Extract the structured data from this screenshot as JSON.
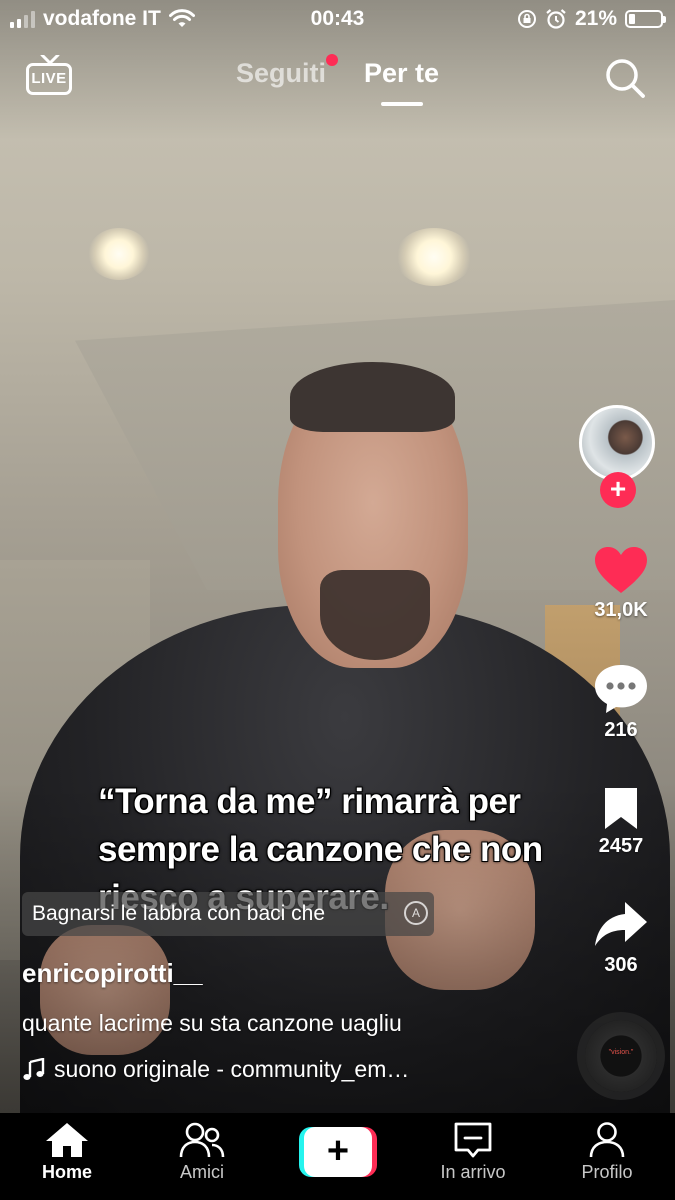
{
  "status_bar": {
    "carrier": "vodafone IT",
    "time": "00:43",
    "battery_percent": "21%",
    "battery_level": 0.21,
    "icons": [
      "signal-icon",
      "wifi-icon",
      "orientation-lock-icon",
      "alarm-icon",
      "battery-icon"
    ]
  },
  "top_nav": {
    "live_label": "LIVE",
    "tabs": [
      {
        "label": "Seguiti",
        "active": false,
        "has_notification_dot": true
      },
      {
        "label": "Per te",
        "active": true
      }
    ],
    "search_icon": "search-icon"
  },
  "video": {
    "overlay_text": "“Torna da me” rimarrà per sempre la canzone che non riesco a superare.",
    "lyrics": "Bagnarsi le labbra con baci che"
  },
  "actions": {
    "follow_label": "+",
    "likes": "31,0K",
    "comments": "216",
    "saves": "2457",
    "shares": "306",
    "like_color": "#fe2c55"
  },
  "post": {
    "username": "enricopirotti__",
    "description": "quante lacrime su sta canzone uagliu",
    "sound": "suono originale - community_em…",
    "disc_label": "\"vision.\""
  },
  "tab_bar": {
    "items": [
      {
        "label": "Home",
        "icon": "home-icon",
        "active": true
      },
      {
        "label": "Amici",
        "icon": "friends-icon",
        "active": false
      },
      {
        "label": "+",
        "icon": "create-icon",
        "active": false
      },
      {
        "label": "In arrivo",
        "icon": "inbox-icon",
        "active": false
      },
      {
        "label": "Profilo",
        "icon": "profile-icon",
        "active": false
      }
    ]
  },
  "colors": {
    "accent_red": "#fe2c55",
    "accent_cyan": "#25f4ee",
    "tabbar_bg": "#000000"
  }
}
